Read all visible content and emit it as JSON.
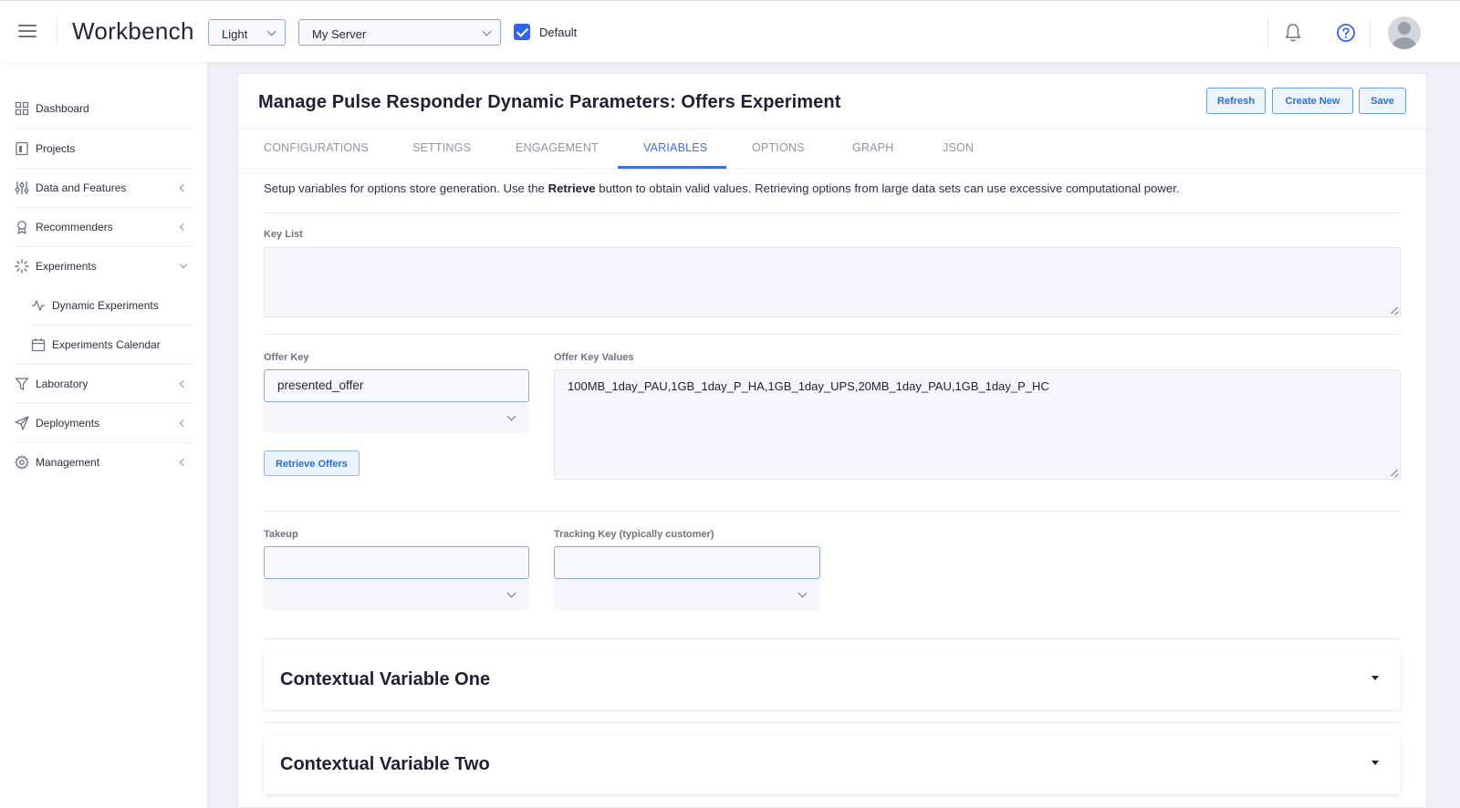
{
  "app": {
    "title": "Workbench",
    "theme_select": "Light",
    "server_select": "My Server",
    "default_label": "Default",
    "default_checked": true
  },
  "sidebar": {
    "items": [
      {
        "label": "Dashboard",
        "icon": "grid-icon"
      },
      {
        "label": "Projects",
        "icon": "project-icon"
      },
      {
        "label": "Data and Features",
        "icon": "sliders-icon"
      },
      {
        "label": "Recommenders",
        "icon": "award-icon"
      },
      {
        "label": "Experiments",
        "icon": "loader-icon"
      },
      {
        "label": "Dynamic Experiments",
        "icon": "activity-icon"
      },
      {
        "label": "Experiments Calendar",
        "icon": "calendar-icon"
      },
      {
        "label": "Laboratory",
        "icon": "filter-icon"
      },
      {
        "label": "Deployments",
        "icon": "send-icon"
      },
      {
        "label": "Management",
        "icon": "gear-icon"
      }
    ]
  },
  "main": {
    "title": "Manage Pulse Responder Dynamic Parameters: Offers Experiment",
    "buttons": {
      "refresh": "Refresh",
      "create_new": "Create New",
      "save": "Save"
    },
    "tabs": [
      "CONFIGURATIONS",
      "SETTINGS",
      "ENGAGEMENT",
      "VARIABLES",
      "OPTIONS",
      "GRAPH",
      "JSON"
    ],
    "active_tab": "VARIABLES",
    "description": {
      "before": "Setup variables for options store generation. Use the ",
      "bold": "Retrieve",
      "after": " button to obtain valid values. Retrieving options from large data sets can use excessive computational power."
    },
    "key_list": {
      "label": "Key List",
      "value": ""
    },
    "offer_key": {
      "label": "Offer Key",
      "value": "presented_offer",
      "dropdown_value": ""
    },
    "retrieve_button": "Retrieve Offers",
    "offer_key_values": {
      "label": "Offer Key Values",
      "value": "100MB_1day_PAU,1GB_1day_P_HA,1GB_1day_UPS,20MB_1day_PAU,1GB_1day_P_HC"
    },
    "takeup": {
      "label": "Takeup",
      "value": ""
    },
    "tracking_key": {
      "label": "Tracking Key (typically customer)",
      "value": ""
    },
    "accordions": [
      "Contextual Variable One",
      "Contextual Variable Two"
    ]
  },
  "colors": {
    "accent": "#3d6fe0",
    "button_text": "#2a6ed3",
    "checkbox": "#2f64ee",
    "background": "#eef0f7"
  }
}
